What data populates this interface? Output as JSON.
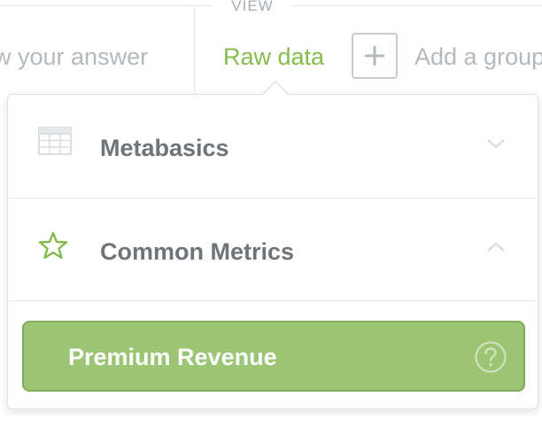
{
  "toolbar": {
    "view_label": "VIEW",
    "show_answer_label": "ow your answer",
    "raw_data_label": "Raw data",
    "add_group_label": "Add a group",
    "add_icon": "plus-icon",
    "accent_color": "#84bb4c"
  },
  "popover": {
    "sections": [
      {
        "label": "Metabasics",
        "icon": "table-icon",
        "expanded": false
      },
      {
        "label": "Common Metrics",
        "icon": "star-icon",
        "expanded": true
      }
    ],
    "items": [
      {
        "label": "Premium Revenue",
        "selected": true,
        "icon": "help-icon"
      }
    ],
    "selected_color": "#9bc475"
  }
}
